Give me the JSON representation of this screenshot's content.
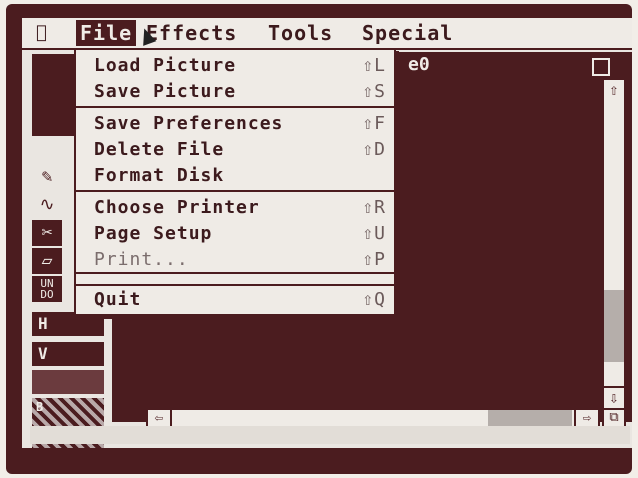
{
  "menubar": {
    "apple_glyph": "",
    "items": [
      "File",
      "Effects",
      "Tools",
      "Special"
    ]
  },
  "file_menu": {
    "items": [
      {
        "label": "Load Picture",
        "shortcut": "⇧L"
      },
      {
        "label": "Save Picture",
        "shortcut": "⇧S"
      },
      {
        "label": "Save Preferences",
        "shortcut": "⇧F"
      },
      {
        "label": "Delete File",
        "shortcut": "⇧D"
      },
      {
        "label": "Format Disk",
        "shortcut": ""
      },
      {
        "label": "Choose Printer",
        "shortcut": "⇧R"
      },
      {
        "label": "Page Setup",
        "shortcut": "⇧U"
      },
      {
        "label": "Print...",
        "shortcut": "⇧P"
      },
      {
        "label": "Quit",
        "shortcut": "⇧Q"
      }
    ]
  },
  "window": {
    "title_fragment": "e0"
  },
  "palette": {
    "pencil_glyph": "✎",
    "curve_glyph": "∿",
    "scissors_glyph": "✂",
    "eraser_glyph": "▱",
    "undo_label_line1": "UN",
    "undo_label_line2": "DO",
    "h_label": "H",
    "v_label": "V",
    "pattern_label": "B"
  },
  "scrollbars": {
    "up_glyph": "⇧",
    "down_glyph": "⇩",
    "left_glyph": "⇦",
    "right_glyph": "⇨",
    "resize_glyph": "⧉"
  },
  "colors": {
    "bezel": "#4b1c1f",
    "screen": "#eae6e1",
    "accent": "#4b1c1f"
  }
}
